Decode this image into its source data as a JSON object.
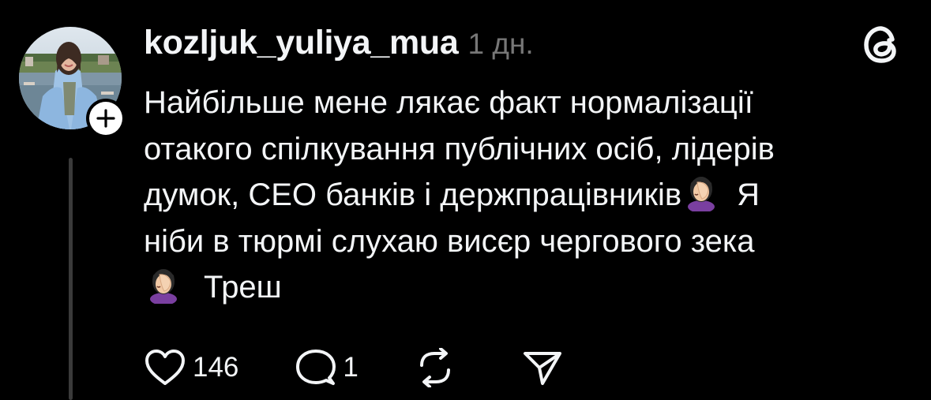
{
  "post": {
    "username": "kozljuk_yuliya_mua",
    "timestamp": "1 дн.",
    "text_lines": [
      "Найбільше мене лякає факт нормалізації",
      "отакого спілкування публічних осіб, лідерів",
      "думок, CEO банків і держпрацівників",
      "Я",
      "ніби в тюрмі слухаю висєр чергового зека",
      "Треш"
    ],
    "emoji": "woman-facepalming",
    "likes": "146",
    "replies": "1"
  },
  "icons": {
    "platform": "threads-icon",
    "follow": "plus-icon",
    "like": "heart-icon",
    "reply": "comment-icon",
    "repost": "repost-icon",
    "share": "send-icon"
  },
  "colors": {
    "background": "#000000",
    "text": "#f3f5f7",
    "muted": "#777777",
    "thread_line": "#3a3a3a"
  }
}
